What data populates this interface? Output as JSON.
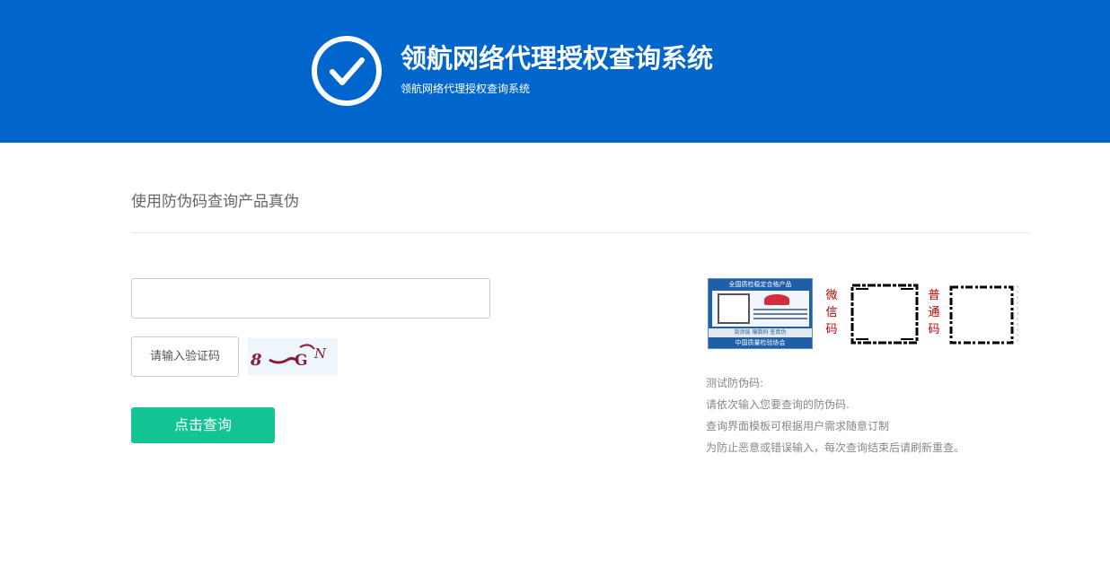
{
  "header": {
    "title": "领航网络代理授权查询系统",
    "subtitle": "领航网络代理授权查询系统",
    "colors": {
      "background": "#0066cc",
      "text": "#ffffff"
    }
  },
  "main": {
    "section_title": "使用防伪码查询产品真伪",
    "code_input": {
      "value": "",
      "placeholder": ""
    },
    "captcha_input": {
      "value": "",
      "placeholder": "请输入验证码"
    },
    "captcha_text": "8 GN",
    "submit_label": "点击查询",
    "submit_color": "#12c493"
  },
  "sample": {
    "label_top": "全国质检稳定合格产品",
    "label_middle": "刮涂层  输数码  查真伪",
    "label_bottom": "中国质量检验协会",
    "wechat_code_label": "微信码",
    "normal_code_label": "普通码",
    "label_color": "#c00000"
  },
  "notes": {
    "lines": [
      "测试防伪码:",
      "请依次输入您要查询的防伪码.",
      "查询界面模板可根据用户需求随意订制",
      "为防止恶意或错误输入，每次查询结束后请刷新重查。"
    ]
  }
}
